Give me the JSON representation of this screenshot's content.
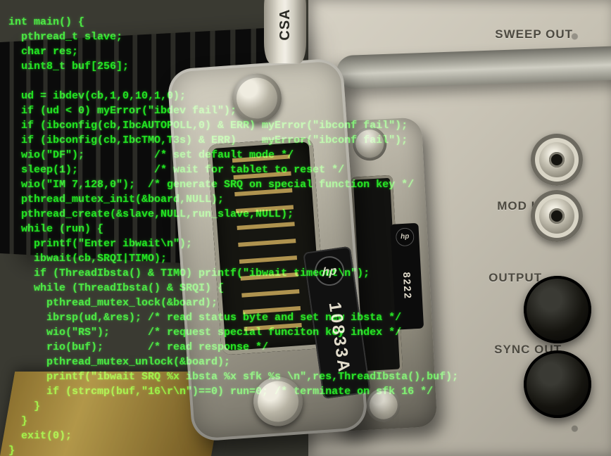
{
  "probe_stamp": "CSA",
  "main_connector_model": "10833A",
  "secondary_connector_model": "8222",
  "panel_labels": {
    "sweep": "SWEEP OUT",
    "mod": "MOD INP",
    "out": "OUTPUT",
    "sync": "SYNC OUT"
  },
  "code_lines": [
    "int main() {",
    "  pthread_t slave;",
    "  char res;",
    "  uint8_t buf[256];",
    "",
    "  ud = ibdev(cb,1,0,10,1,0);",
    "  if (ud < 0) myError(\"ibdev fail\");",
    "  if (ibconfig(cb,IbcAUTOPOLL,0) & ERR) myError(\"ibconf fail\");",
    "  if (ibconfig(cb,IbcTMO,T3s) & ERR)    myError(\"ibconf fail\");",
    "  wio(\"DF\");           /* set default mode */",
    "  sleep(1);            /* wait for tablet to reset */",
    "  wio(\"IM 7,128,0\");  /* generate SRQ on special function key */",
    "  pthread_mutex_init(&board,NULL);",
    "  pthread_create(&slave,NULL,run_slave,NULL);",
    "  while (run) {",
    "    printf(\"Enter ibwait\\n\");",
    "    ibwait(cb,SRQI|TIMO);",
    "    if (ThreadIbsta() & TIMO) printf(\"ibwait timeout\\n\");",
    "    while (ThreadIbsta() & SRQI) {",
    "      pthread_mutex_lock(&board);",
    "      ibrsp(ud,&res); /* read status byte and set new ibsta */",
    "      wio(\"RS\");      /* request special funciton key index */",
    "      rio(buf);       /* read response */",
    "      pthread_mutex_unlock(&board);",
    "      printf(\"ibwait SRQ %x ibsta %x sfk %s \\n\",res,ThreadIbsta(),buf);",
    "      if (strcmp(buf,\"16\\r\\n\")==0) run=0; /* terminate on sfk 16 */",
    "    }",
    "  }",
    "  exit(0);",
    "}"
  ]
}
